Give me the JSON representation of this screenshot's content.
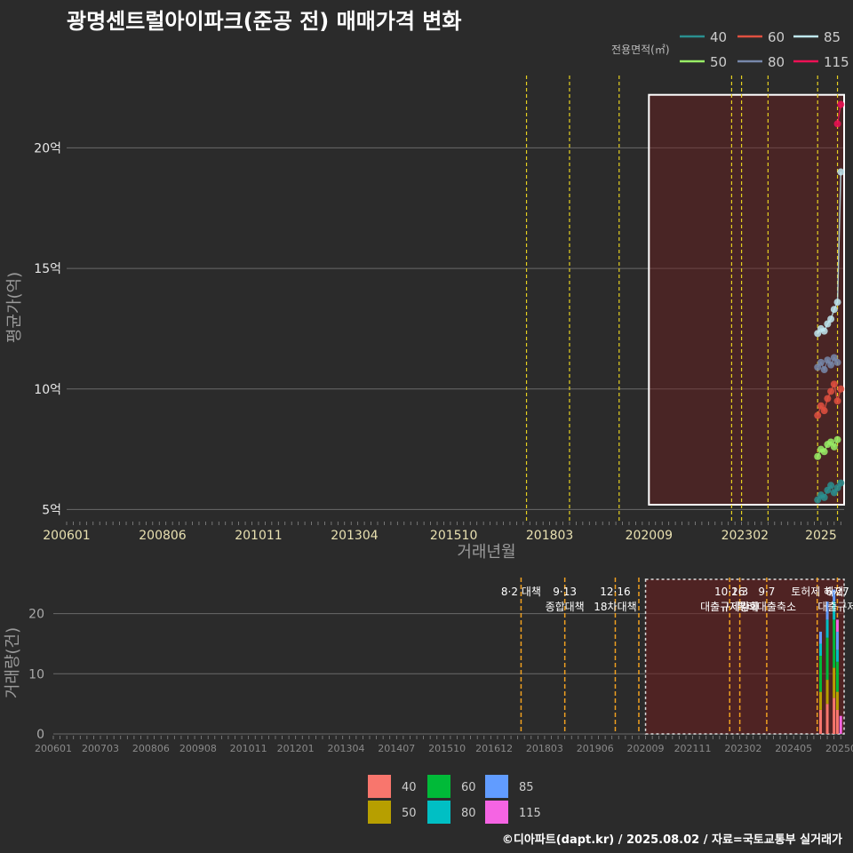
{
  "title": "광명센트럴아이파크(준공 전) 매매가격 변화",
  "legend_title": "전용면적(㎡)",
  "caption": "©디아파트(dapt.kr) / 2025.08.02 / 자료=국토교통부 실거래가",
  "chart_data": [
    {
      "type": "scatter",
      "name": "price",
      "xlabel": "거래년월",
      "ylabel": "평균가(억)",
      "x_range": [
        "2006-01",
        "2025-08"
      ],
      "ylim": [
        4.5,
        23
      ],
      "y_ticks": [
        5,
        10,
        15,
        20
      ],
      "y_tick_labels": [
        "5억",
        "10억",
        "15억",
        "20억"
      ],
      "x_ticks": [
        "200601",
        "200806",
        "201011",
        "201304",
        "201510",
        "201803",
        "202009",
        "202302",
        "2025"
      ],
      "highlight_box": {
        "x_from": "2020-09",
        "x_to": "2025-08",
        "y_from": 5.2,
        "y_to": 22.2
      },
      "policy_lines": [
        "2017-08",
        "2018-09",
        "2019-12",
        "2022-10",
        "2023-01",
        "2023-09",
        "2024-12",
        "2025-06"
      ],
      "series": [
        {
          "name": "40",
          "color": "#2a8f8f",
          "points": [
            {
              "x": "2024-12",
              "y": 5.4
            },
            {
              "x": "2025-01",
              "y": 5.6
            },
            {
              "x": "2025-02",
              "y": 5.5
            },
            {
              "x": "2025-03",
              "y": 5.8
            },
            {
              "x": "2025-04",
              "y": 6.0
            },
            {
              "x": "2025-05",
              "y": 5.7
            },
            {
              "x": "2025-06",
              "y": 5.9
            },
            {
              "x": "2025-07",
              "y": 6.1
            }
          ]
        },
        {
          "name": "50",
          "color": "#99ee66",
          "points": [
            {
              "x": "2024-12",
              "y": 7.2
            },
            {
              "x": "2025-01",
              "y": 7.5
            },
            {
              "x": "2025-02",
              "y": 7.4
            },
            {
              "x": "2025-03",
              "y": 7.7
            },
            {
              "x": "2025-04",
              "y": 7.8
            },
            {
              "x": "2025-05",
              "y": 7.6
            },
            {
              "x": "2025-06",
              "y": 7.9
            }
          ]
        },
        {
          "name": "60",
          "color": "#e05040",
          "points": [
            {
              "x": "2024-12",
              "y": 8.9
            },
            {
              "x": "2025-01",
              "y": 9.3
            },
            {
              "x": "2025-02",
              "y": 9.1
            },
            {
              "x": "2025-03",
              "y": 9.6
            },
            {
              "x": "2025-04",
              "y": 9.9
            },
            {
              "x": "2025-05",
              "y": 10.2
            },
            {
              "x": "2025-06",
              "y": 9.5
            },
            {
              "x": "2025-07",
              "y": 10.0
            }
          ]
        },
        {
          "name": "80",
          "color": "#7788aa",
          "points": [
            {
              "x": "2024-12",
              "y": 10.9
            },
            {
              "x": "2025-01",
              "y": 11.1
            },
            {
              "x": "2025-02",
              "y": 10.8
            },
            {
              "x": "2025-03",
              "y": 11.2
            },
            {
              "x": "2025-04",
              "y": 11.0
            },
            {
              "x": "2025-05",
              "y": 11.3
            },
            {
              "x": "2025-06",
              "y": 11.1
            }
          ]
        },
        {
          "name": "85",
          "color": "#bfe8f0",
          "points": [
            {
              "x": "2024-12",
              "y": 12.3
            },
            {
              "x": "2025-01",
              "y": 12.5
            },
            {
              "x": "2025-02",
              "y": 12.4
            },
            {
              "x": "2025-03",
              "y": 12.7
            },
            {
              "x": "2025-04",
              "y": 12.9
            },
            {
              "x": "2025-05",
              "y": 13.3
            },
            {
              "x": "2025-06",
              "y": 13.6
            },
            {
              "x": "2025-07",
              "y": 19.0
            }
          ]
        },
        {
          "name": "115",
          "color": "#ee1155",
          "points": [
            {
              "x": "2025-06",
              "y": 21.0
            },
            {
              "x": "2025-07",
              "y": 21.8
            }
          ]
        }
      ]
    },
    {
      "type": "bar",
      "name": "volume",
      "ylabel": "거래량(건)",
      "ylim": [
        0,
        26
      ],
      "y_ticks": [
        0,
        10,
        20
      ],
      "x_ticks": [
        "200601",
        "200703",
        "200806",
        "200908",
        "201011",
        "201201",
        "201304",
        "201407",
        "201510",
        "201612",
        "201803",
        "201906",
        "202009",
        "202111",
        "202302",
        "202405",
        "202508"
      ],
      "highlight_box": {
        "x_from": "2020-09",
        "x_to": "2025-08",
        "y_from": 0,
        "y_to": 26
      },
      "policy_lines": [
        "2017-08",
        "2018-09",
        "2019-12",
        "2020-07",
        "2022-10",
        "2023-01",
        "2023-09",
        "2024-12",
        "2025-06"
      ],
      "policy_labels": [
        {
          "x": "2017-08",
          "lines": [
            "8·2 대책"
          ]
        },
        {
          "x": "2018-09",
          "lines": [
            "9·13",
            "종합대책"
          ]
        },
        {
          "x": "2019-12",
          "lines": [
            "12·16",
            "18차대책"
          ]
        },
        {
          "x": "2022-10",
          "lines": [
            "10·26",
            "대출규제강화"
          ]
        },
        {
          "x": "2023-01",
          "lines": [
            "1·3",
            "규제완화"
          ]
        },
        {
          "x": "2023-09",
          "lines": [
            "9·7",
            "특례대출축소"
          ]
        },
        {
          "x": "2024-12",
          "lines": [
            "토허제 해제"
          ]
        },
        {
          "x": "2025-06",
          "lines": [
            "6·27",
            "대출규제"
          ]
        }
      ],
      "series": [
        {
          "name": "40",
          "color": "#f8766d",
          "values": [
            {
              "x": "2025-01",
              "v": 4
            },
            {
              "x": "2025-03",
              "v": 5
            },
            {
              "x": "2025-05",
              "v": 6
            },
            {
              "x": "2025-06",
              "v": 4
            }
          ]
        },
        {
          "name": "50",
          "color": "#b79f00",
          "values": [
            {
              "x": "2025-01",
              "v": 3
            },
            {
              "x": "2025-03",
              "v": 4
            },
            {
              "x": "2025-05",
              "v": 5
            },
            {
              "x": "2025-06",
              "v": 3
            }
          ]
        },
        {
          "name": "60",
          "color": "#00ba38",
          "values": [
            {
              "x": "2025-01",
              "v": 6
            },
            {
              "x": "2025-03",
              "v": 7
            },
            {
              "x": "2025-05",
              "v": 8
            },
            {
              "x": "2025-06",
              "v": 5
            }
          ]
        },
        {
          "name": "80",
          "color": "#00bfc4",
          "values": [
            {
              "x": "2025-01",
              "v": 2
            },
            {
              "x": "2025-03",
              "v": 3
            },
            {
              "x": "2025-05",
              "v": 3
            },
            {
              "x": "2025-06",
              "v": 2
            }
          ]
        },
        {
          "name": "85",
          "color": "#619cff",
          "values": [
            {
              "x": "2025-01",
              "v": 2
            },
            {
              "x": "2025-03",
              "v": 3
            },
            {
              "x": "2025-05",
              "v": 2
            },
            {
              "x": "2025-06",
              "v": 3
            }
          ]
        },
        {
          "name": "115",
          "color": "#f564e3",
          "values": [
            {
              "x": "2025-06",
              "v": 2
            },
            {
              "x": "2025-07",
              "v": 3
            }
          ]
        }
      ]
    }
  ]
}
